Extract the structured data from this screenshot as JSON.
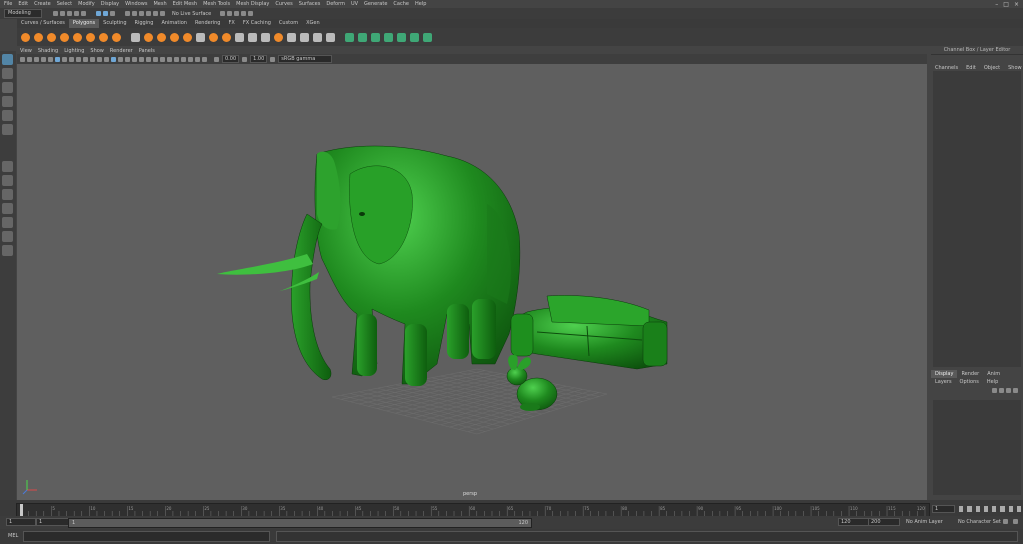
{
  "menubar": {
    "items": [
      "File",
      "Edit",
      "Create",
      "Select",
      "Modify",
      "Display",
      "Windows",
      "Mesh",
      "Edit Mesh",
      "Mesh Tools",
      "Mesh Display",
      "Curves",
      "Surfaces",
      "Deform",
      "UV",
      "Generate",
      "Cache",
      "Help"
    ]
  },
  "status": {
    "mode": "Modeling",
    "live": "No Live Surface"
  },
  "shelf": {
    "tabs": [
      "Curves / Surfaces",
      "Polygons",
      "Sculpting",
      "Rigging",
      "Animation",
      "Rendering",
      "FX",
      "FX Caching",
      "Custom",
      "XGen"
    ],
    "active_tab": 1
  },
  "panel": {
    "menus": [
      "View",
      "Shading",
      "Lighting",
      "Show",
      "Renderer",
      "Panels"
    ],
    "field_a": "0.00",
    "field_b": "1.00",
    "colorspace": "sRGB gamma",
    "camera_label": "persp"
  },
  "channel_box": {
    "title": "Channel Box / Layer Editor",
    "menus": [
      "Channels",
      "Edit",
      "Object",
      "Show"
    ]
  },
  "layer_editor": {
    "tabs": [
      "Display",
      "Render",
      "Anim"
    ],
    "active_tab": 0,
    "menus": [
      "Layers",
      "Options",
      "Help"
    ]
  },
  "time": {
    "current_frame": "1",
    "range_start": "1",
    "playback_start": "1",
    "slider_end": "120",
    "range_end": "120",
    "playback_end": "200",
    "anim_layer": "No Anim Layer",
    "char_set": "No Character Set",
    "ticks": [
      "5",
      "10",
      "15",
      "20",
      "25",
      "30",
      "35",
      "40",
      "45",
      "50",
      "55",
      "60",
      "65",
      "70",
      "75",
      "80",
      "85",
      "90",
      "95",
      "100",
      "105",
      "110",
      "115",
      "120"
    ]
  },
  "cmd": {
    "lang": "MEL"
  },
  "colors": {
    "mesh": "#1f8a1f",
    "mesh_dark": "#0f5a0f",
    "mesh_light": "#5fd85f",
    "viewport_bg": "#5f5f5f"
  }
}
